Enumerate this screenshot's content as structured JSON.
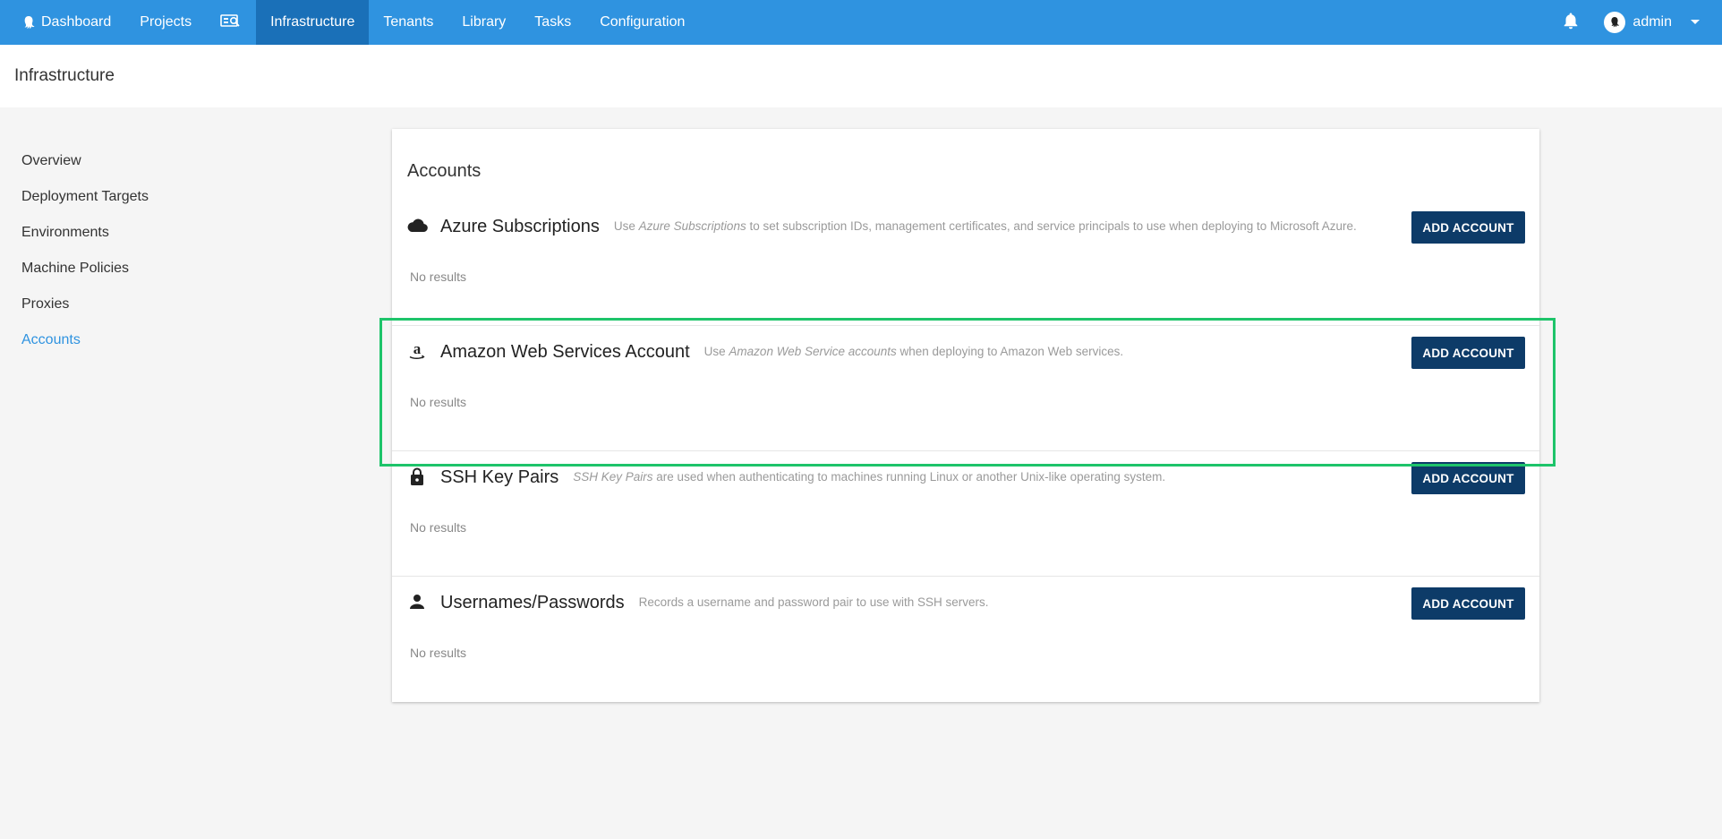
{
  "nav": {
    "items": [
      {
        "label": "Dashboard",
        "icon": "octopus-icon"
      },
      {
        "label": "Projects"
      },
      {
        "label": "",
        "icon": "search-machines-icon"
      },
      {
        "label": "Infrastructure",
        "active": true
      },
      {
        "label": "Tenants"
      },
      {
        "label": "Library"
      },
      {
        "label": "Tasks"
      },
      {
        "label": "Configuration"
      }
    ],
    "user": "admin"
  },
  "page": {
    "title": "Infrastructure"
  },
  "sidebar": {
    "items": [
      {
        "label": "Overview"
      },
      {
        "label": "Deployment Targets"
      },
      {
        "label": "Environments"
      },
      {
        "label": "Machine Policies"
      },
      {
        "label": "Proxies"
      },
      {
        "label": "Accounts",
        "active": true
      }
    ]
  },
  "accounts": {
    "title": "Accounts",
    "add_label": "ADD ACCOUNT",
    "no_results": "No results",
    "sections": [
      {
        "title": "Azure Subscriptions",
        "icon": "cloud-icon",
        "desc_pre": "Use ",
        "desc_em": "Azure Subscriptions",
        "desc_post": " to set subscription IDs, management certificates, and service principals to use when deploying to Microsoft Azure."
      },
      {
        "title": "Amazon Web Services Account",
        "icon": "amazon-icon",
        "desc_pre": "Use ",
        "desc_em": "Amazon Web Service accounts",
        "desc_post": " when deploying to Amazon Web services."
      },
      {
        "title": "SSH Key Pairs",
        "icon": "lock-icon",
        "desc_pre": "",
        "desc_em": "SSH Key Pairs",
        "desc_post": " are used when authenticating to machines running Linux or another Unix-like operating system."
      },
      {
        "title": "Usernames/Passwords",
        "icon": "person-icon",
        "desc_pre": "Records a username and password pair to use with SSH servers.",
        "desc_em": "",
        "desc_post": ""
      }
    ]
  },
  "colors": {
    "nav_bg": "#2f93e0",
    "nav_active": "#1a70b8",
    "button": "#0d3b68",
    "highlight": "#1ec46a",
    "link_active": "#2f93e0"
  }
}
